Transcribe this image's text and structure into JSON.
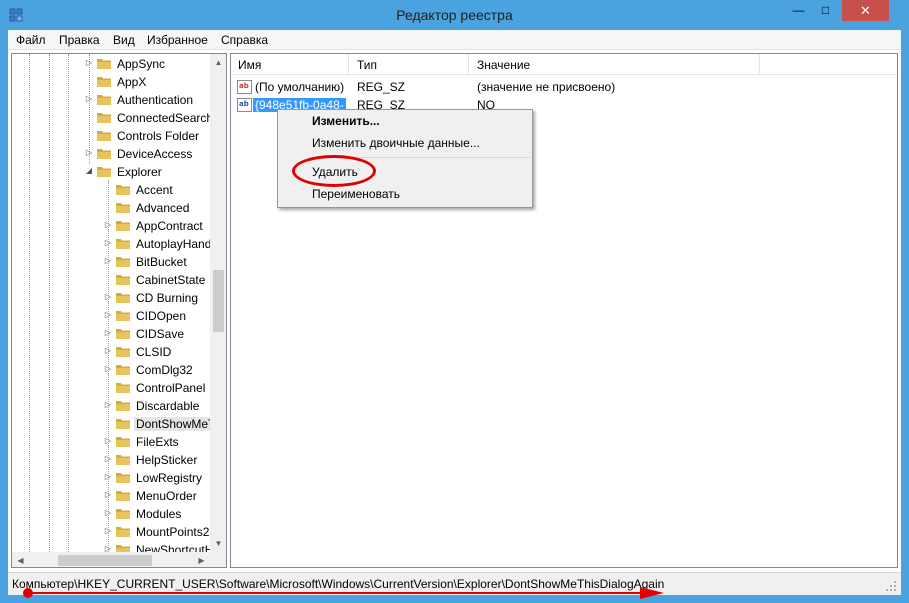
{
  "window": {
    "title": "Редактор реестра",
    "close_glyph": "✕",
    "min_glyph": "—",
    "max_glyph": "□"
  },
  "menu": [
    "Файл",
    "Правка",
    "Вид",
    "Избранное",
    "Справка"
  ],
  "tree": {
    "level1": [
      {
        "label": "AppSync",
        "expandable": true
      },
      {
        "label": "AppX",
        "expandable": false
      },
      {
        "label": "Authentication",
        "expandable": true
      },
      {
        "label": "ConnectedSearch",
        "expandable": false
      },
      {
        "label": "Controls Folder",
        "expandable": false
      },
      {
        "label": "DeviceAccess",
        "expandable": true
      },
      {
        "label": "Explorer",
        "expandable": true,
        "expanded": true
      }
    ],
    "level2": [
      {
        "label": "Accent",
        "expandable": false
      },
      {
        "label": "Advanced",
        "expandable": false
      },
      {
        "label": "AppContract",
        "expandable": true
      },
      {
        "label": "AutoplayHand",
        "expandable": true
      },
      {
        "label": "BitBucket",
        "expandable": true
      },
      {
        "label": "CabinetState",
        "expandable": false
      },
      {
        "label": "CD Burning",
        "expandable": true
      },
      {
        "label": "CIDOpen",
        "expandable": true
      },
      {
        "label": "CIDSave",
        "expandable": true
      },
      {
        "label": "CLSID",
        "expandable": true
      },
      {
        "label": "ComDlg32",
        "expandable": true
      },
      {
        "label": "ControlPanel",
        "expandable": false
      },
      {
        "label": "Discardable",
        "expandable": true
      },
      {
        "label": "DontShowMeT",
        "expandable": false,
        "selected": true
      },
      {
        "label": "FileExts",
        "expandable": true
      },
      {
        "label": "HelpSticker",
        "expandable": true
      },
      {
        "label": "LowRegistry",
        "expandable": true
      },
      {
        "label": "MenuOrder",
        "expandable": true
      },
      {
        "label": "Modules",
        "expandable": true
      },
      {
        "label": "MountPoints2",
        "expandable": true
      },
      {
        "label": "NewShortcutH",
        "expandable": true
      }
    ]
  },
  "list": {
    "columns": [
      "Имя",
      "Тип",
      "Значение"
    ],
    "rows": [
      {
        "name": "(По умолчанию)",
        "type": "REG_SZ",
        "value": "(значение не присвоено)",
        "icon": "ab"
      },
      {
        "name": "{948e51fb-0a48-",
        "type": "REG_SZ",
        "value": "NO",
        "icon": "ab",
        "selected": true
      }
    ]
  },
  "context_menu": {
    "items": [
      "Изменить...",
      "Изменить двоичные данные...",
      "Удалить",
      "Переименовать"
    ],
    "highlighted": "Удалить"
  },
  "status": {
    "path": "Компьютер\\HKEY_CURRENT_USER\\Software\\Microsoft\\Windows\\CurrentVersion\\Explorer\\DontShowMeThisDialogAgain"
  },
  "colors": {
    "titlebar": "#4aa3df",
    "close": "#c7504c",
    "selection": "#3399ff",
    "annotation": "#e00000",
    "folder": "#e8c45f"
  }
}
